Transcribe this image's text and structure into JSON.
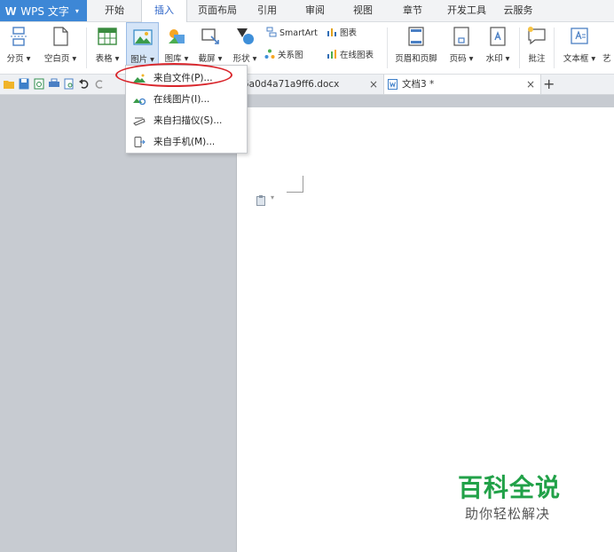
{
  "app": {
    "logo": "W",
    "title": "WPS 文字",
    "arrow": "▾"
  },
  "menu_tabs": [
    "开始",
    "插入",
    "页面布局",
    "引用",
    "审阅",
    "视图",
    "章节",
    "开发工具",
    "云服务"
  ],
  "ribbon": {
    "page_break": "分页 ▾",
    "blank_page": "空白页 ▾",
    "table": "表格 ▾",
    "picture": "图片 ▾",
    "gallery": "图库 ▾",
    "screenshot": "截屏 ▾",
    "shape": "形状 ▾",
    "smartart": "SmartArt",
    "chart": "图表",
    "relation": "关系图",
    "online_chart": "在线图表",
    "header_footer": "页眉和页脚",
    "page_number": "页码 ▾",
    "watermark": "水印 ▾",
    "comment": "批注",
    "textbox": "文本框 ▾",
    "art": "艺"
  },
  "doc_tabs": [
    {
      "label": "5a0d4a71a9ff6.docx",
      "close": "×"
    },
    {
      "label": "文档3 *",
      "close": "×"
    }
  ],
  "new_tab": "+",
  "dropdown": {
    "items": [
      "来自文件(P)...",
      "在线图片(I)...",
      "来自扫描仪(S)...",
      "来自手机(M)..."
    ]
  },
  "document": {
    "paste_arrow": "▾"
  },
  "watermark": {
    "title": "百科全说",
    "subtitle": "助你轻松解决"
  },
  "colors": {
    "accent": "#3d87d6",
    "active_tab": "#2a62c7",
    "watermark": "#21a148",
    "highlight": "#d9262c"
  }
}
